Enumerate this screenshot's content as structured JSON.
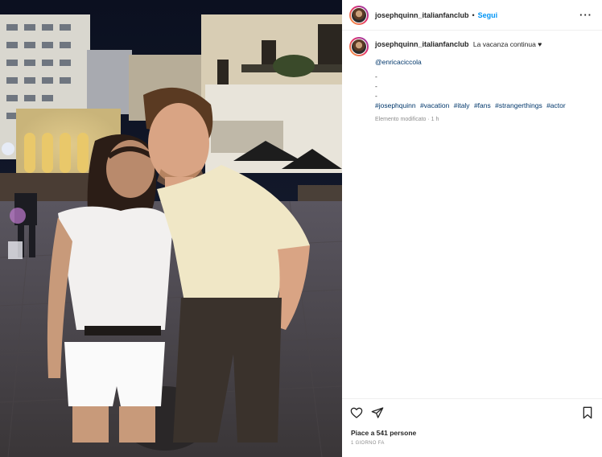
{
  "post": {
    "photo_alt": "",
    "username": "josephquinn_italianfanclub",
    "separator": "•",
    "follow_label": "Segui",
    "more_label": "···"
  },
  "caption": {
    "username": "josephquinn_italianfanclub",
    "text": "La vacanza continua ♥",
    "mention": "@enricaciccola",
    "dots": [
      "-",
      "-",
      "-"
    ],
    "hashtags": [
      "#josephquinn",
      "#vacation",
      "#italy",
      "#fans",
      "#strangerthings",
      "#actor"
    ],
    "edited": "Elemento modificato · 1 h"
  },
  "footer": {
    "likes": "Piace a 541 persone",
    "date": "1 GIORNO FA"
  },
  "icons": {
    "like": "heart-icon",
    "share": "paper-plane-icon",
    "save": "bookmark-icon",
    "more": "more-options-icon"
  },
  "colors": {
    "follow": "#0095f6",
    "link": "#00376b",
    "muted": "#8e8e8e"
  }
}
